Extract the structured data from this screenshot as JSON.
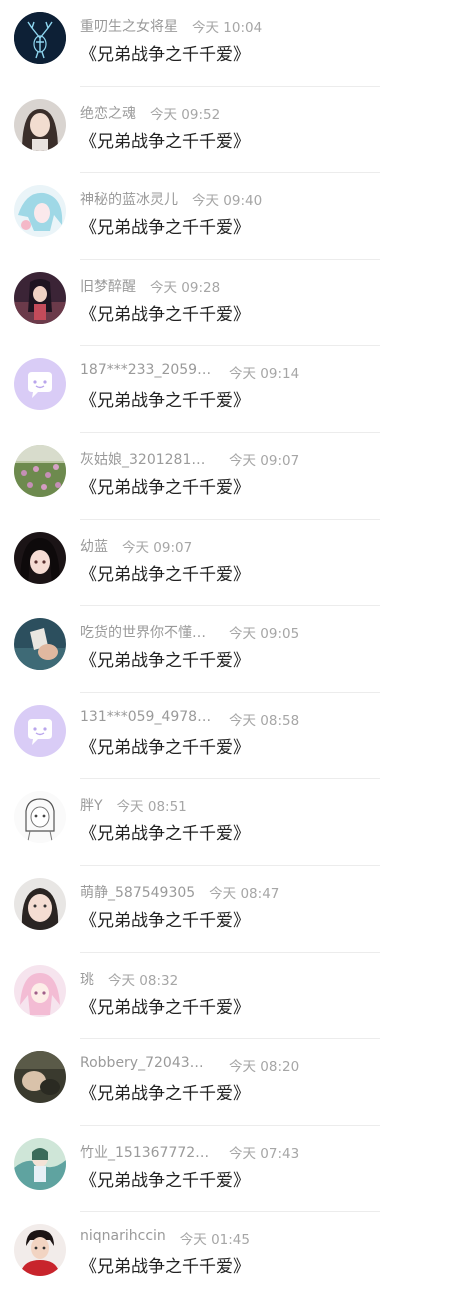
{
  "comments": [
    {
      "name": "重叨生之女将星",
      "time": "今天 10:04",
      "text": "《兄弟战争之千千爱》",
      "avatar": "avatar-deer-icon"
    },
    {
      "name": "绝恋之魂",
      "time": "今天 09:52",
      "text": "《兄弟战争之千千爱》",
      "avatar": "avatar-girl-photo"
    },
    {
      "name": "神秘的蓝冰灵儿",
      "time": "今天 09:40",
      "text": "《兄弟战争之千千爱》",
      "avatar": "avatar-anime-blue"
    },
    {
      "name": "旧梦醉醒",
      "time": "今天 09:28",
      "text": "《兄弟战争之千千爱》",
      "avatar": "avatar-anime-dark"
    },
    {
      "name": "187***233_2059…",
      "time": "今天 09:14",
      "text": "《兄弟战争之千千爱》",
      "avatar": "default-chat-icon"
    },
    {
      "name": "灰姑娘_3201281…",
      "time": "今天 09:07",
      "text": "《兄弟战争之千千爱》",
      "avatar": "avatar-flower-field"
    },
    {
      "name": "幼蓝",
      "time": "今天 09:07",
      "text": "《兄弟战争之千千爱》",
      "avatar": "avatar-anime-hair"
    },
    {
      "name": "吃货的世界你不懂…",
      "time": "今天 09:05",
      "text": "《兄弟战争之千千爱》",
      "avatar": "avatar-hand-cup"
    },
    {
      "name": "131***059_4978…",
      "time": "今天 08:58",
      "text": "《兄弟战争之千千爱》",
      "avatar": "default-chat-icon"
    },
    {
      "name": "胖Y",
      "time": "今天 08:51",
      "text": "《兄弟战争之千千爱》",
      "avatar": "avatar-sketch-girl"
    },
    {
      "name": "萌静_587549305",
      "time": "今天 08:47",
      "text": "《兄弟战争之千千爱》",
      "avatar": "avatar-girl-face"
    },
    {
      "name": "珧",
      "time": "今天 08:32",
      "text": "《兄弟战争之千千爱》",
      "avatar": "avatar-anime-pink"
    },
    {
      "name": "Robbery_72043…",
      "time": "今天 08:20",
      "text": "《兄弟战争之千千爱》",
      "avatar": "avatar-dark-photo"
    },
    {
      "name": "竹业_151367772…",
      "time": "今天 07:43",
      "text": "《兄弟战争之千千爱》",
      "avatar": "avatar-anime-green"
    },
    {
      "name": "niqnarihccin",
      "time": "今天 01:45",
      "text": "《兄弟战争之千千爱》",
      "avatar": "avatar-boy-red"
    }
  ]
}
